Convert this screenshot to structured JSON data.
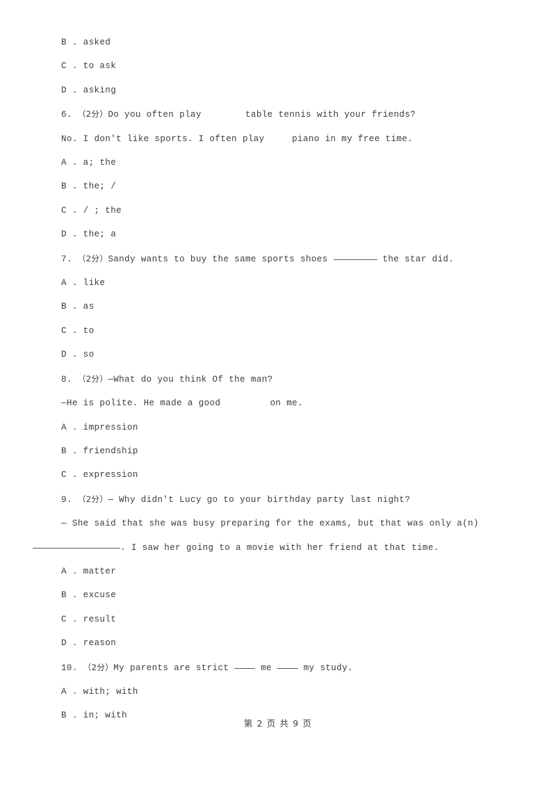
{
  "document": {
    "page_footer": "第 2 页 共 9 页",
    "page_number": "2",
    "total_pages": "9",
    "text_color": "#3c3c3c",
    "background_color": "#ffffff"
  },
  "carryover_options": [
    {
      "label": "B .",
      "text": "asked"
    },
    {
      "label": "C .",
      "text": "to ask"
    },
    {
      "label": "D .",
      "text": "asking"
    }
  ],
  "questions": [
    {
      "number": "6.",
      "mark": "（2分）",
      "stem_before": "Do you often play",
      "stem_blank_gap": "        ",
      "stem_after": "table tennis with your friends?",
      "stem_line2_before": "No. I don't like sports. I often play",
      "stem_line2_gap": "     ",
      "stem_line2_after": "piano in my free time.",
      "options": [
        {
          "label": "A .",
          "text": "a; the"
        },
        {
          "label": "B .",
          "text": "the; /"
        },
        {
          "label": "C .",
          "text": "/ ; the"
        },
        {
          "label": "D .",
          "text": "the; a"
        }
      ]
    },
    {
      "number": "7.",
      "mark": "（2分）",
      "stem_before": "Sandy wants to buy the same sports shoes ",
      "stem_after": " the star did.",
      "options": [
        {
          "label": "A .",
          "text": "like"
        },
        {
          "label": "B .",
          "text": "as"
        },
        {
          "label": "C .",
          "text": "to"
        },
        {
          "label": "D .",
          "text": "so"
        }
      ]
    },
    {
      "number": "8.",
      "mark": "（2分）",
      "stem_before": "—What do you think Of the man?",
      "stem_line2_before": "—He is polite. He made a good",
      "stem_line2_gap": "         ",
      "stem_line2_after": "on me.",
      "options": [
        {
          "label": "A .",
          "text": "impression"
        },
        {
          "label": "B .",
          "text": "friendship"
        },
        {
          "label": "C .",
          "text": "expression"
        }
      ]
    },
    {
      "number": "9.",
      "mark": "（2分）",
      "stem_before": "— Why didn't Lucy go to your birthday party last night?",
      "justified_line": "— She said that she was busy preparing for the exams, but that was only a(n)",
      "stem_line2_after": ". I saw her going to a movie with her friend at that time.",
      "options": [
        {
          "label": "A .",
          "text": "matter"
        },
        {
          "label": "B .",
          "text": "excuse"
        },
        {
          "label": "C .",
          "text": "result"
        },
        {
          "label": "D .",
          "text": "reason"
        }
      ]
    },
    {
      "number": "10.",
      "mark": "（2分）",
      "stem_before": "My parents are strict ",
      "stem_mid": " me ",
      "stem_after": " my study.",
      "options": [
        {
          "label": "A .",
          "text": "with; with"
        },
        {
          "label": "B .",
          "text": "in; with"
        }
      ]
    }
  ]
}
